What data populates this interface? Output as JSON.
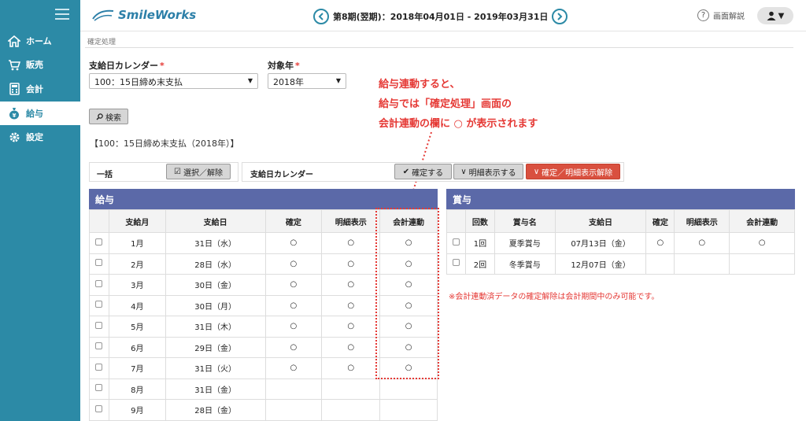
{
  "sidebar": {
    "items": [
      {
        "label": "ホーム",
        "icon": "home-icon"
      },
      {
        "label": "販売",
        "icon": "cart-icon"
      },
      {
        "label": "会計",
        "icon": "calculator-icon"
      },
      {
        "label": "給与",
        "icon": "money-bag-icon",
        "active": true
      },
      {
        "label": "設定",
        "icon": "gear-icon"
      }
    ]
  },
  "header": {
    "logo_text": "SmileWorks",
    "period": "第8期(翌期)：2018年04月01日 - 2019年03月31日",
    "help_label": "画面解説"
  },
  "breadcrumb": "確定処理",
  "form": {
    "calendar_label": "支給日カレンダー",
    "calendar_value": "100：15日締め末支払",
    "year_label": "対象年",
    "year_value": "2018年",
    "search_label": "検索"
  },
  "result_note": "【100：15日締め末支払（2018年）】",
  "annotation": {
    "line1": "給与連動すると、",
    "line2": "給与では「確定処理」画面の",
    "line3": "会計連動の欄に ○ が表示されます"
  },
  "bulk": {
    "label": "一括",
    "select_button": "選択／解除",
    "calendar_label": "支給日カレンダー",
    "confirm_button": "確定する",
    "detail_button": "明細表示する",
    "cancel_button": "確定／明細表示解除"
  },
  "salary": {
    "title": "給与",
    "headers": [
      "",
      "支給月",
      "支給日",
      "確定",
      "明細表示",
      "会計連動"
    ],
    "rows": [
      {
        "month": "1月",
        "day": "31日（水）",
        "confirm": "○",
        "detail": "○",
        "link": "○"
      },
      {
        "month": "2月",
        "day": "28日（水）",
        "confirm": "○",
        "detail": "○",
        "link": "○"
      },
      {
        "month": "3月",
        "day": "30日（金）",
        "confirm": "○",
        "detail": "○",
        "link": "○"
      },
      {
        "month": "4月",
        "day": "30日（月）",
        "confirm": "○",
        "detail": "○",
        "link": "○"
      },
      {
        "month": "5月",
        "day": "31日（木）",
        "confirm": "○",
        "detail": "○",
        "link": "○"
      },
      {
        "month": "6月",
        "day": "29日（金）",
        "confirm": "○",
        "detail": "○",
        "link": "○"
      },
      {
        "month": "7月",
        "day": "31日（火）",
        "confirm": "○",
        "detail": "○",
        "link": "○"
      },
      {
        "month": "8月",
        "day": "31日（金）",
        "confirm": "",
        "detail": "",
        "link": ""
      },
      {
        "month": "9月",
        "day": "28日（金）",
        "confirm": "",
        "detail": "",
        "link": ""
      }
    ]
  },
  "bonus": {
    "title": "賞与",
    "headers": [
      "",
      "回数",
      "賞与名",
      "支給日",
      "確定",
      "明細表示",
      "会計連動"
    ],
    "rows": [
      {
        "count": "1回",
        "name": "夏季賞与",
        "day": "07月13日（金）",
        "confirm": "○",
        "detail": "○",
        "link": "○"
      },
      {
        "count": "2回",
        "name": "冬季賞与",
        "day": "12月07日（金）",
        "confirm": "",
        "detail": "",
        "link": ""
      }
    ]
  },
  "warning": "※会計連動済データの確定解除は会計期間中のみ可能です。",
  "colors": {
    "sidebar": "#2c8aa6",
    "panel_header": "#5b69a8",
    "accent_red": "#e53935"
  }
}
